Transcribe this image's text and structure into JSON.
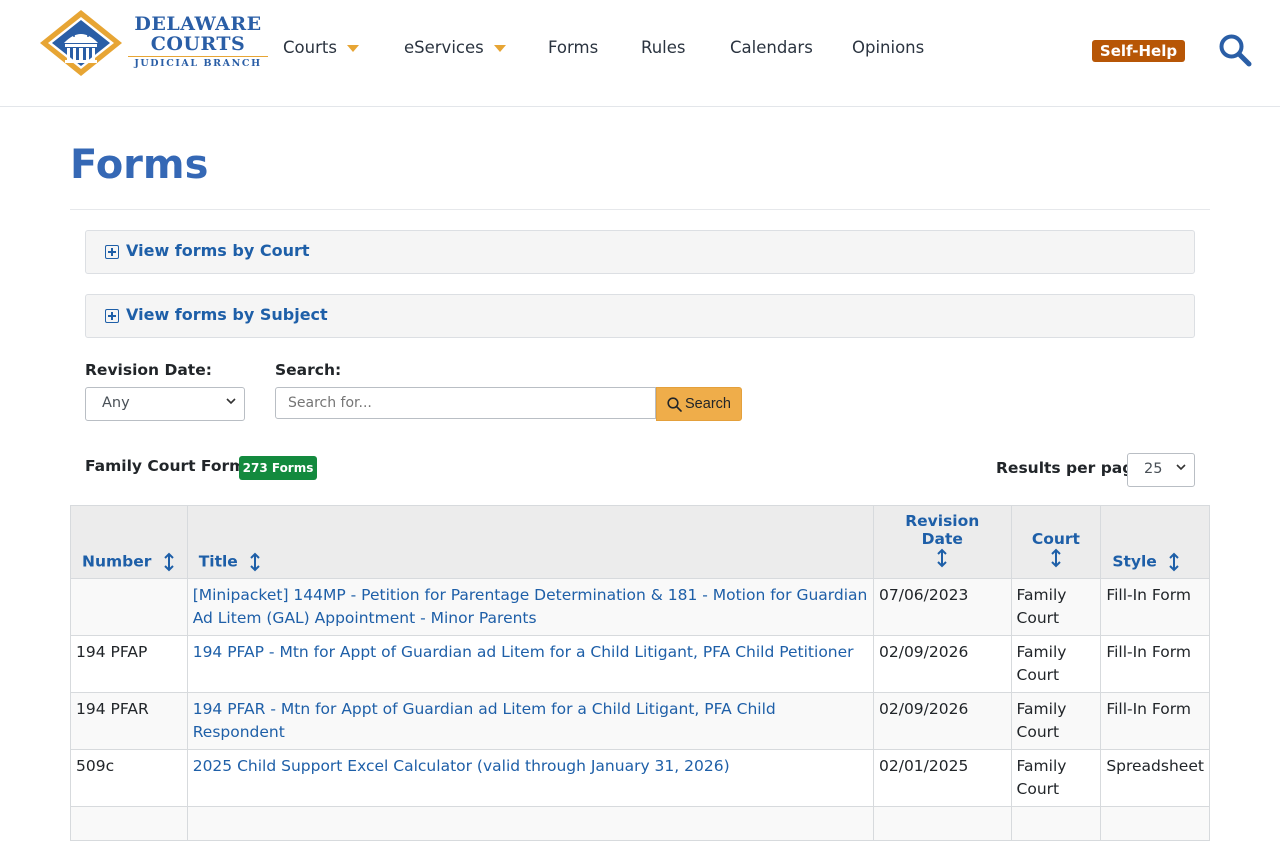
{
  "brand": {
    "line1": "DELAWARE",
    "line2": "COURTS",
    "line3": "JUDICIAL BRANCH"
  },
  "nav": [
    {
      "label": "Courts",
      "dropdown": true
    },
    {
      "label": "eServices",
      "dropdown": true
    },
    {
      "label": "Forms",
      "dropdown": false
    },
    {
      "label": "Rules",
      "dropdown": false
    },
    {
      "label": "Calendars",
      "dropdown": false
    },
    {
      "label": "Opinions",
      "dropdown": false
    }
  ],
  "self_help": "Self-Help",
  "page_title": "Forms",
  "accordions": [
    {
      "label": "View forms by Court"
    },
    {
      "label": "View forms by Subject"
    }
  ],
  "filters": {
    "revision_label": "Revision Date:",
    "revision_value": "Any",
    "search_label": "Search:",
    "search_placeholder": "Search for...",
    "search_button": "Search"
  },
  "results": {
    "label": "Family Court Forms",
    "badge": "273 Forms",
    "per_page_label": "Results per page",
    "per_page_value": "25"
  },
  "table": {
    "headers": {
      "number": "Number",
      "title": "Title",
      "revision_date": "Revision Date",
      "court": "Court",
      "style": "Style"
    },
    "rows": [
      {
        "number": "",
        "title": "[Minipacket] 144MP - Petition for Parentage Determination & 181 - Motion for Guardian Ad Litem (GAL) Appointment - Minor Parents",
        "date": "07/06/2023",
        "court": "Family Court",
        "style": "Fill-In Form"
      },
      {
        "number": "194 PFAP",
        "title": "194 PFAP - Mtn for Appt of Guardian ad Litem for a Child Litigant, PFA Child Petitioner",
        "date": "02/09/2026",
        "court": "Family Court",
        "style": "Fill-In Form"
      },
      {
        "number": "194 PFAR",
        "title": "194 PFAR - Mtn for Appt of Guardian ad Litem for a Child Litigant, PFA Child Respondent",
        "date": "02/09/2026",
        "court": "Family Court",
        "style": "Fill-In Form"
      },
      {
        "number": "509c",
        "title": "2025 Child Support Excel Calculator (valid through January 31, 2026)",
        "date": "02/01/2025",
        "court": "Family Court",
        "style": "Spreadsheet"
      },
      {
        "number": "",
        "title": "",
        "date": "",
        "court": "",
        "style": ""
      }
    ]
  },
  "colors": {
    "brand_blue": "#3568b5",
    "link_blue": "#1e5fa8",
    "gold": "#e7a534",
    "self_help": "#b75606",
    "badge": "#138a3e"
  },
  "icons": {
    "search": "search-icon",
    "expand": "plus-square-icon",
    "sort": "sort-arrows-icon",
    "caret": "caret-down-icon"
  }
}
